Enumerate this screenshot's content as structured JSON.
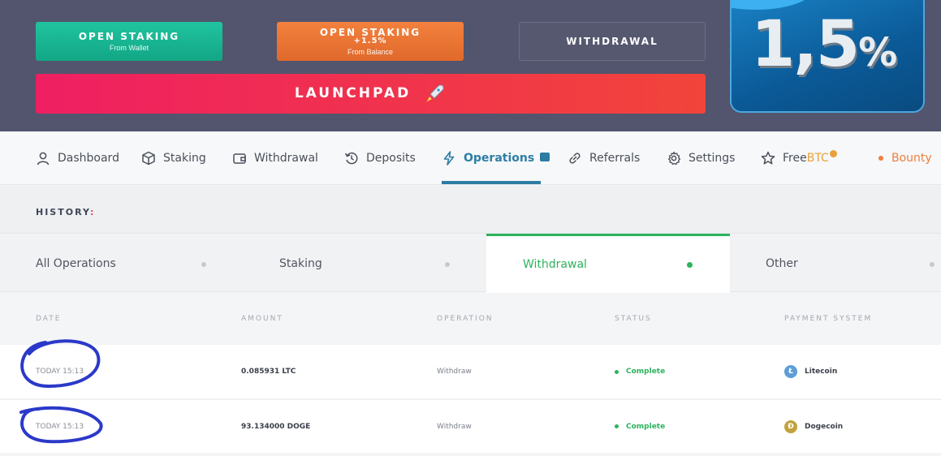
{
  "banner": {
    "open_staking_wallet": {
      "title": "OPEN STAKING",
      "subtitle": "From Wallet"
    },
    "open_staking_balance": {
      "title": "OPEN STAKING",
      "extra": "+1.5%",
      "subtitle": "From Balance"
    },
    "withdrawal": {
      "title": "WITHDRAWAL"
    },
    "launchpad": {
      "title": "LAUNCHPAD",
      "icon": "rocket-icon"
    },
    "promo": {
      "value": "1,5",
      "suffix": "%"
    }
  },
  "nav": {
    "items": [
      {
        "label": "Dashboard",
        "icon": "user-icon"
      },
      {
        "label": "Staking",
        "icon": "cube-icon"
      },
      {
        "label": "Withdrawal",
        "icon": "wallet-icon"
      },
      {
        "label": "Deposits",
        "icon": "history-icon"
      },
      {
        "label": "Operations",
        "icon": "lightning-icon"
      },
      {
        "label": "Referrals",
        "icon": "link-icon"
      },
      {
        "label": "Settings",
        "icon": "gear-icon"
      },
      {
        "label": "Free",
        "label_suffix": "BTC",
        "icon": "star-icon"
      },
      {
        "label": "Bounty",
        "icon": "dot-icon"
      }
    ],
    "active": "Operations"
  },
  "history": {
    "title": "HISTORY",
    "colon": ":",
    "tabs": [
      {
        "label": "All Operations"
      },
      {
        "label": "Staking"
      },
      {
        "label": "Withdrawal"
      },
      {
        "label": "Other"
      }
    ],
    "active_tab": "Withdrawal"
  },
  "table": {
    "headers": [
      "DATE",
      "AMOUNT",
      "OPERATION",
      "STATUS",
      "PAYMENT SYSTEM"
    ],
    "rows": [
      {
        "date": "TODAY 15:13",
        "amount": "0.085931 LTC",
        "operation": "Withdraw",
        "status": "Complete",
        "payment": "Litecoin",
        "coin_icon": "litecoin-icon"
      },
      {
        "date": "TODAY 15:13",
        "amount": "93.134000 DOGE",
        "operation": "Withdraw",
        "status": "Complete",
        "payment": "Dogecoin",
        "coin_icon": "dogecoin-icon"
      }
    ]
  },
  "colors": {
    "banner_bg": "#52556d",
    "accent_blue": "#2c7ca3",
    "accent_green": "#2db35d",
    "launch_pink": "#ef1f62",
    "staking_teal": "#20c4a0",
    "staking_orange": "#f3813d",
    "annotation_circle": "#2b39c9"
  }
}
